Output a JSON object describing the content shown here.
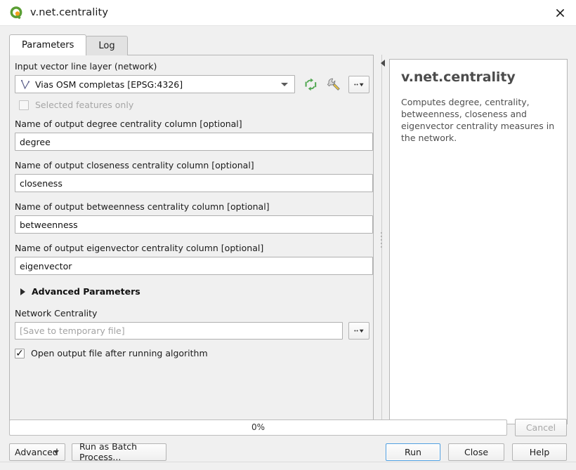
{
  "window": {
    "title": "v.net.centrality",
    "app_icon": "qgis-logo-icon",
    "close_icon": "close-icon"
  },
  "tabs": [
    {
      "label": "Parameters",
      "selected": true
    },
    {
      "label": "Log",
      "selected": false
    }
  ],
  "parameters": {
    "input_layer": {
      "label": "Input vector line layer (network)",
      "value": "Vias OSM completas [EPSG:4326]",
      "layer_icon": "line-layer-icon",
      "iterate_icon": "iterate-over-features-icon",
      "advanced_icon": "wrench-icon",
      "dots_label": "…"
    },
    "selected_features": {
      "label": "Selected features only",
      "checked": false,
      "enabled": false
    },
    "degree": {
      "label": "Name of output degree centrality column [optional]",
      "value": "degree"
    },
    "closeness": {
      "label": "Name of output closeness centrality column [optional]",
      "value": "closeness"
    },
    "betweenness": {
      "label": "Name of output betweenness centrality column [optional]",
      "value": "betweenness"
    },
    "eigenvector": {
      "label": "Name of output eigenvector centrality column [optional]",
      "value": "eigenvector"
    },
    "advanced_section": {
      "label": "Advanced Parameters",
      "expanded": false
    },
    "output": {
      "label": "Network Centrality",
      "value": "",
      "placeholder": "[Save to temporary file]",
      "dots_label": "…"
    },
    "open_output": {
      "label": "Open output file after running algorithm",
      "checked": true,
      "check_glyph": "✓"
    }
  },
  "help": {
    "collapse_icon": "collapse-panel-icon",
    "title": "v.net.centrality",
    "description": "Computes degree, centrality, betweenness, closeness and eigenvector centrality measures in the network."
  },
  "footer": {
    "progress": {
      "text": "0%",
      "percent": 0
    },
    "cancel_label": "Cancel",
    "advanced_label": "Advanced",
    "batch_label": "Run as Batch Process...",
    "run_label": "Run",
    "close_label": "Close",
    "help_label": "Help"
  },
  "colors": {
    "accent_blue": "#4f9fe0",
    "qgis_green": "#589632",
    "qgis_orange": "#f0a01e",
    "panel_bg": "#f0f0f0",
    "field_bg": "#ffffff"
  }
}
